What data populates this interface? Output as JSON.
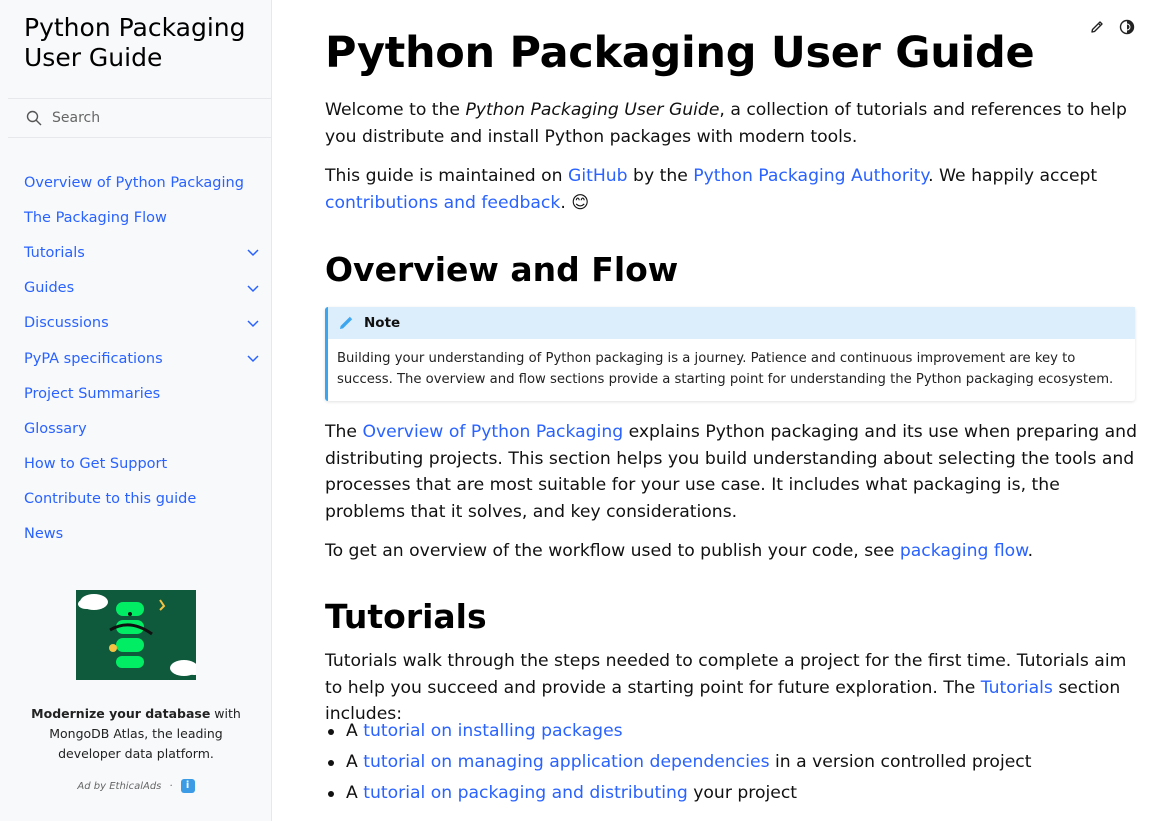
{
  "sidebar": {
    "brand": "Python Packaging User Guide",
    "search_placeholder": "Search",
    "items": [
      {
        "label": "Overview of Python Packaging",
        "expandable": false
      },
      {
        "label": "The Packaging Flow",
        "expandable": false
      },
      {
        "label": "Tutorials",
        "expandable": true
      },
      {
        "label": "Guides",
        "expandable": true
      },
      {
        "label": "Discussions",
        "expandable": true
      },
      {
        "label": "PyPA specifications",
        "expandable": true
      },
      {
        "label": "Project Summaries",
        "expandable": false
      },
      {
        "label": "Glossary",
        "expandable": false
      },
      {
        "label": "How to Get Support",
        "expandable": false
      },
      {
        "label": "Contribute to this guide",
        "expandable": false
      },
      {
        "label": "News",
        "expandable": false
      }
    ],
    "ad": {
      "bold": "Modernize your database",
      "rest": " with MongoDB Atlas, the leading developer data platform.",
      "by": "Ad by EthicalAds",
      "dot": "·",
      "info": "i"
    }
  },
  "page": {
    "title": "Python Packaging User Guide",
    "intro_1a": "Welcome to the ",
    "intro_1em": "Python Packaging User Guide",
    "intro_1b": ", a collection of tutorials and references to help you distribute and install Python packages with modern tools.",
    "intro_2a": "This guide is maintained on ",
    "intro_2_link1": "GitHub",
    "intro_2b": " by the ",
    "intro_2_link2": "Python Packaging Authority",
    "intro_2c": ". We happily accept ",
    "intro_2_link3": "contributions and feedback",
    "intro_2d": ". 😊",
    "h_overview": "Overview and Flow",
    "note": {
      "title": "Note",
      "body": "Building your understanding of Python packaging is a journey. Patience and continuous improvement are key to success. The overview and flow sections provide a starting point for understanding the Python packaging ecosystem."
    },
    "overview_a": "The ",
    "overview_link": "Overview of Python Packaging",
    "overview_b": " explains Python packaging and its use when preparing and distributing projects. This section helps you build understanding about selecting the tools and processes that are most suitable for your use case. It includes what packaging is, the problems that it solves, and key considerations.",
    "flow_a": "To get an overview of the workflow used to publish your code, see ",
    "flow_link": "packaging flow",
    "flow_b": ".",
    "h_tutorials": "Tutorials",
    "tut_a": "Tutorials walk through the steps needed to complete a project for the first time. Tutorials aim to help you succeed and provide a starting point for future exploration. The ",
    "tut_link": "Tutorials",
    "tut_b": " section includes:",
    "list": [
      {
        "pre": "A ",
        "link": "tutorial on installing packages",
        "post": ""
      },
      {
        "pre": "A ",
        "link": "tutorial on managing application dependencies",
        "post": " in a version controlled project"
      },
      {
        "pre": "A ",
        "link": "tutorial on packaging and distributing",
        "post": " your project"
      }
    ]
  },
  "colors": {
    "link": "#2962ff",
    "note_accent": "#3ba5f0",
    "note_bg": "#dcedfb",
    "sidebar_bg": "#f8f9fb"
  }
}
